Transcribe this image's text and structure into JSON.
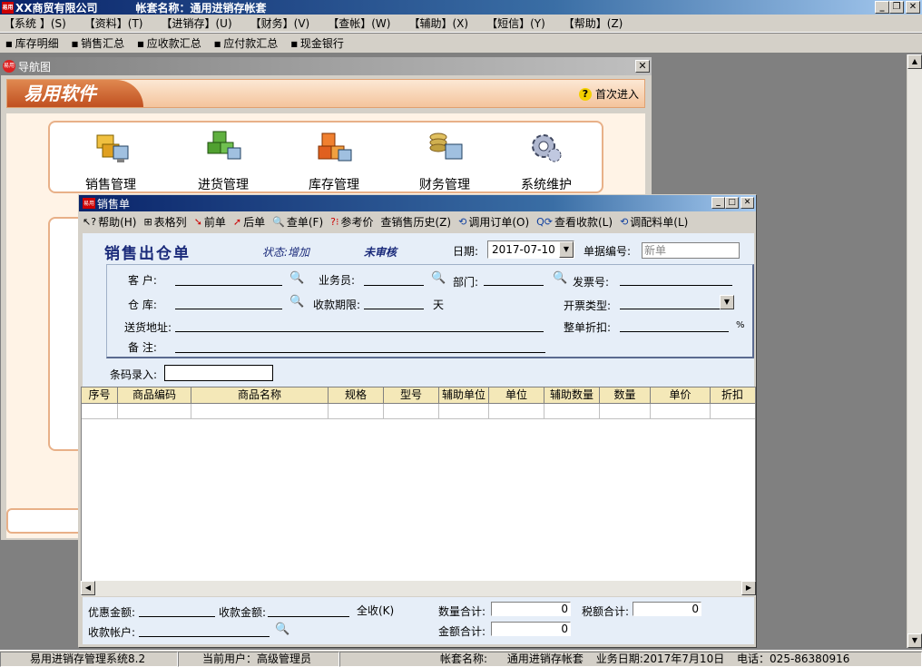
{
  "app": {
    "company": "XX商贸有限公司",
    "account_set": "帐套名称：通用进销存帐套",
    "logo": "易用"
  },
  "menu": [
    "【系统 】(S)",
    "【资料】(T)",
    "【进销存】(U)",
    "【财务】(V)",
    "【查帐】(W)",
    "【辅助】(X)",
    "【短信】(Y)",
    "【帮助】(Z)"
  ],
  "shortcuts": [
    "库存明细",
    "销售汇总",
    "应收款汇总",
    "应付款汇总",
    "现金银行"
  ],
  "nav": {
    "title": "导航图",
    "brand": "易用软件",
    "help": "首次进入",
    "modules": [
      "销售管理",
      "进货管理",
      "库存管理",
      "财务管理",
      "系统维护"
    ]
  },
  "sale": {
    "window_title": "销售单",
    "toolbar": [
      "帮助(H)",
      "表格列",
      "前单",
      "后单",
      "查单(F)",
      "参考价",
      "查销售历史(Z)",
      "调用订单(O)",
      "查看收款(L)",
      "调配料单(L)"
    ],
    "form_title": "销售出仓单",
    "status": "状态:增加",
    "audit": "未审核",
    "date_label": "日期:",
    "date_value": "2017-07-10",
    "no_label": "单据编号:",
    "no_placeholder": "新单",
    "customer_label": "客    户:",
    "salesman_label": "业务员:",
    "dept_label": "部门:",
    "invoice_label": "发票号:",
    "warehouse_label": "仓    库:",
    "term_label": "收款期限:",
    "term_unit": "天",
    "invoice_type_label": "开票类型:",
    "address_label": "送货地址:",
    "discount_label": "整单折扣:",
    "discount_unit": "%",
    "remark_label": "备    注:",
    "barcode_label": "条码录入:",
    "columns": [
      "序号",
      "商品编码",
      "商品名称",
      "规格",
      "型号",
      "辅助单位",
      "单位",
      "辅助数量",
      "数量",
      "单价",
      "折扣"
    ],
    "footer": {
      "discount_amount": "优惠金额:",
      "received_amount": "收款金额:",
      "receive_all": "全收(K)",
      "qty_total_label": "数量合计:",
      "qty_total": "0",
      "tax_total_label": "税额合计:",
      "tax_total": "0",
      "account_label": "收款帐户:",
      "amount_total_label": "金额合计:",
      "amount_total": "0"
    }
  },
  "statusbar": {
    "system": "易用进销存管理系统8.2",
    "user": "当前用户：高级管理员",
    "account_set_label": "帐套名称:",
    "account_set": "通用进销存帐套",
    "business_date": "业务日期:2017年7月10日",
    "phone": "电话：025-86380916"
  }
}
